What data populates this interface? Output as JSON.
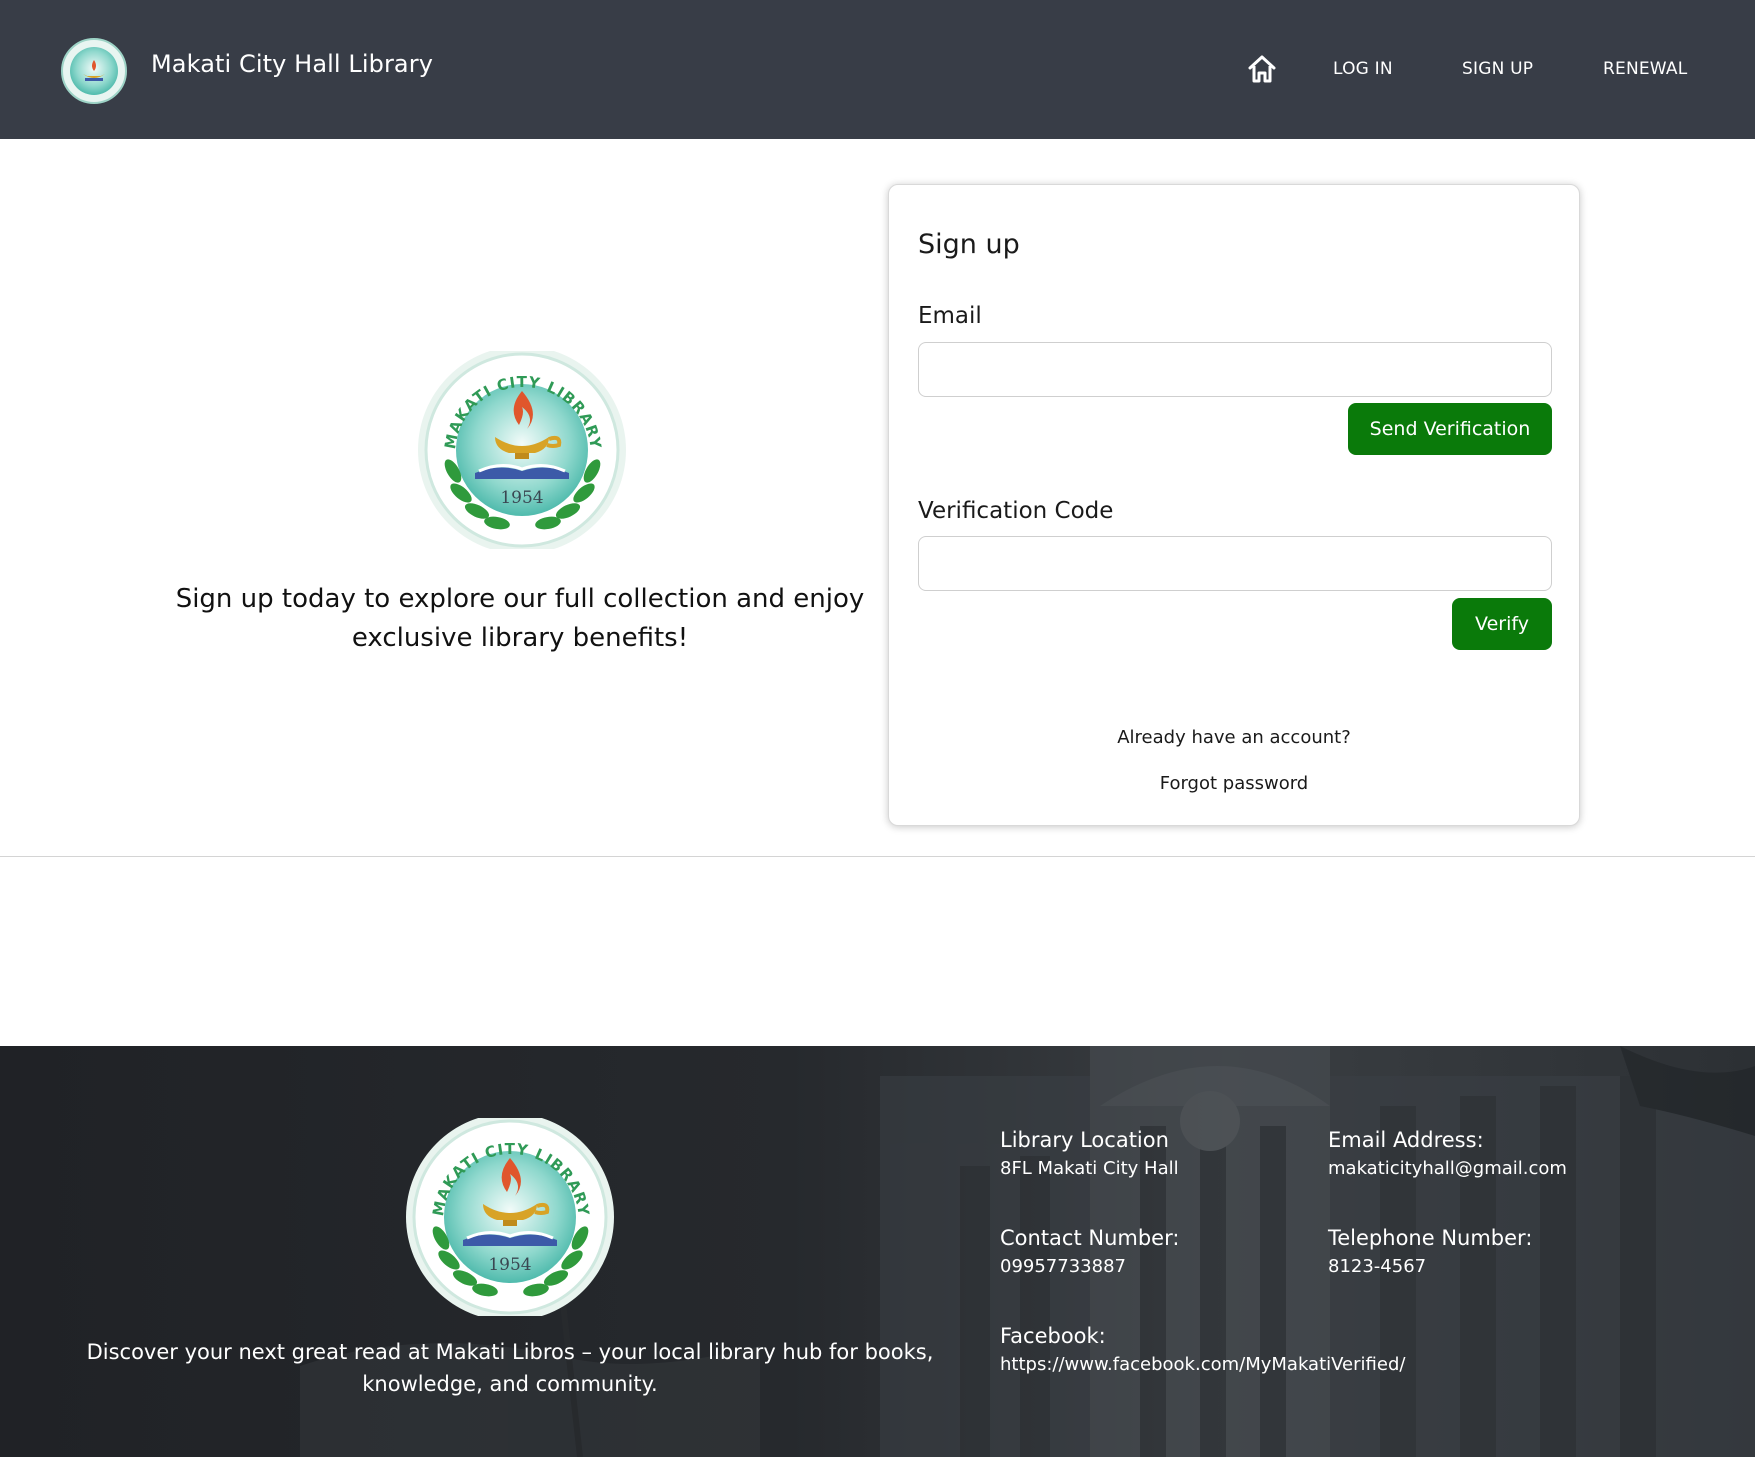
{
  "navbar": {
    "brand": "Makati City Hall Library",
    "links": {
      "login": "LOG IN",
      "signup": "SIGN UP",
      "renewal": "RENEWAL"
    },
    "home_icon": "home-icon",
    "background": "#383d47"
  },
  "hero": {
    "seal_text": "MAKATI CITY LIBRARY",
    "seal_year": "1954",
    "tagline": "Sign up today to explore our full collection and enjoy exclusive library benefits!"
  },
  "signup_form": {
    "title": "Sign up",
    "email_label": "Email",
    "email_value": "",
    "send_button": "Send Verification",
    "code_label": "Verification Code",
    "code_value": "",
    "verify_button": "Verify",
    "already_account": "Already have an account?",
    "forgot_password": "Forgot password",
    "accent": "#0a7a0a"
  },
  "footer": {
    "description": "Discover your next great read at Makati Libros – your local library hub for books, knowledge, and community.",
    "location_label": "Library Location",
    "location_value": "8FL Makati City Hall",
    "email_label": "Email Address:",
    "email_value": "makaticityhall@gmail.com",
    "contact_label": "Contact Number:",
    "contact_value": "09957733887",
    "telephone_label": "Telephone Number:",
    "telephone_value": "8123-4567",
    "facebook_label": "Facebook:",
    "facebook_value": "https://www.facebook.com/MyMakatiVerified/"
  }
}
